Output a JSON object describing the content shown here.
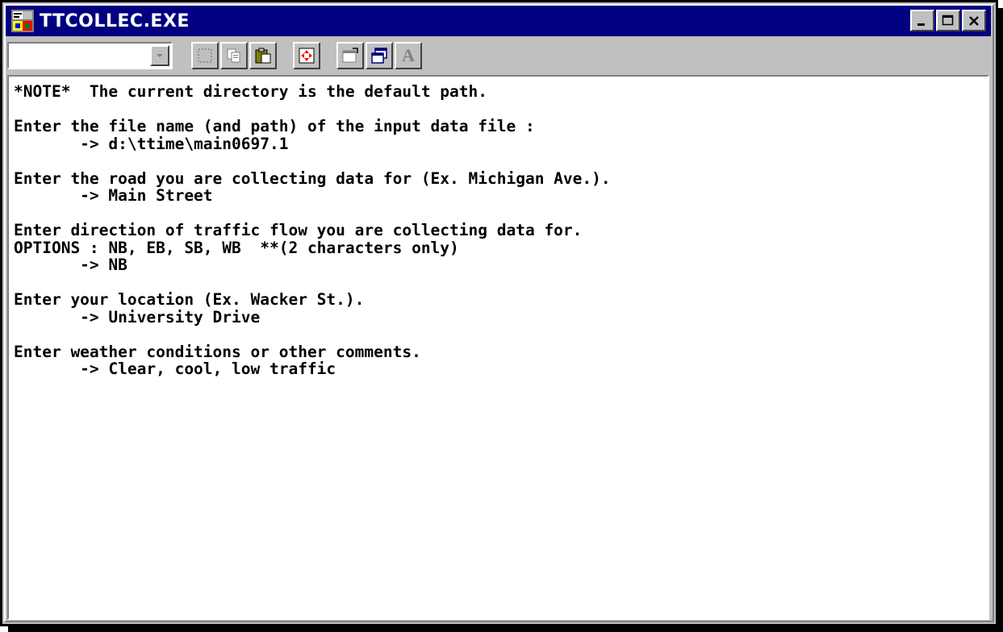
{
  "window": {
    "title": "TTCOLLEC.EXE",
    "app_icon": "ms-dos-app-icon",
    "controls": [
      "minimize-icon",
      "maximize-icon",
      "close-icon"
    ]
  },
  "toolbar": {
    "font_combo_value": "",
    "tools": [
      "mark-icon",
      "copy-icon",
      "paste-icon",
      "fullscreen-icon",
      "properties-icon",
      "background-icon",
      "font-icon"
    ],
    "font_button_label": "A"
  },
  "console": {
    "lines": [
      "*NOTE*  The current directory is the default path.",
      "",
      "Enter the file name (and path) of the input data file :",
      "       -> d:\\ttime\\main0697.1",
      "",
      "Enter the road you are collecting data for (Ex. Michigan Ave.).",
      "       -> Main Street",
      "",
      "Enter direction of traffic flow you are collecting data for.",
      "OPTIONS : NB, EB, SB, WB  **(2 characters only)",
      "       -> NB",
      "",
      "Enter your location (Ex. Wacker St.).",
      "       -> University Drive",
      "",
      "Enter weather conditions or other comments.",
      "       -> Clear, cool, low traffic"
    ]
  },
  "colors": {
    "titlebar": "#000080",
    "face": "#c0c0c0",
    "console_bg": "#ffffff",
    "console_text": "#000000"
  }
}
